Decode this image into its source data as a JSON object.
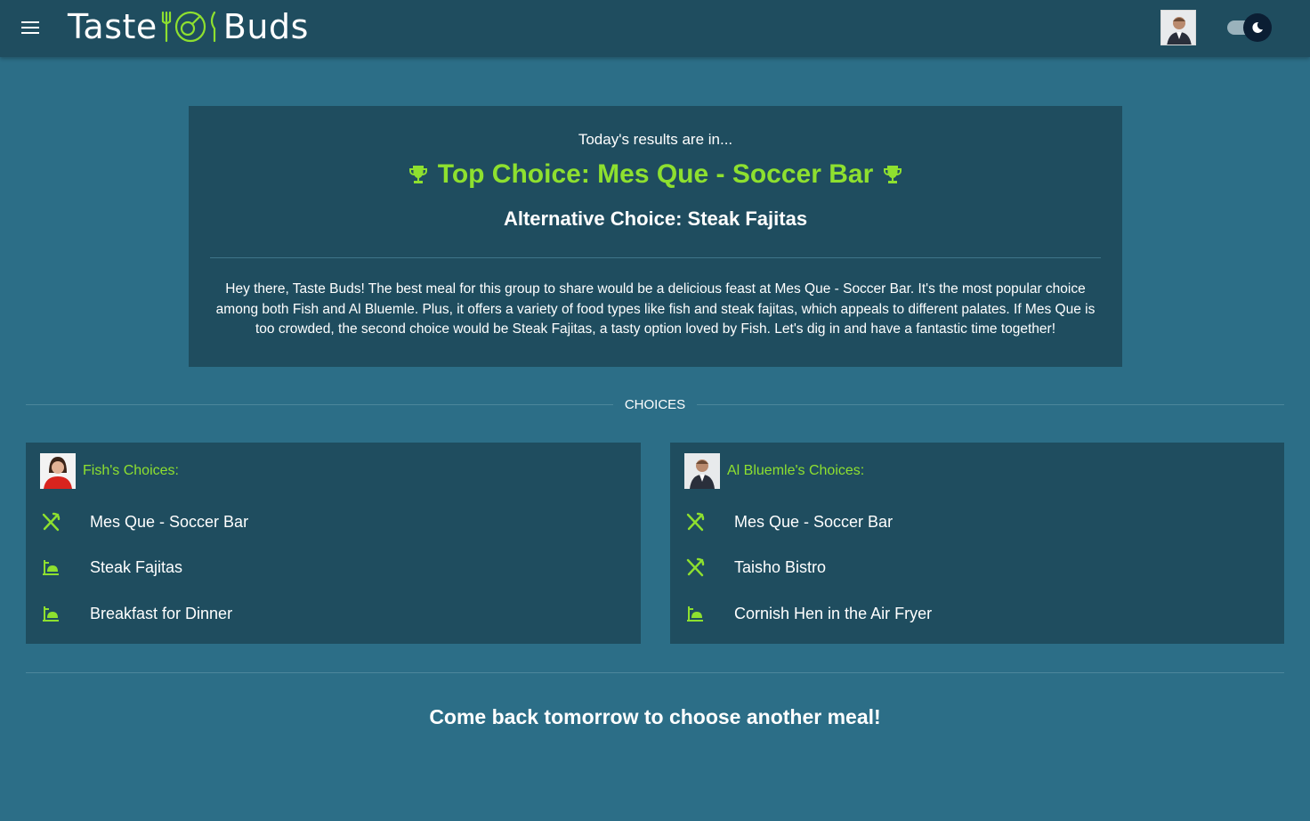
{
  "app": {
    "logo_left": "Taste",
    "logo_right": "Buds"
  },
  "colors": {
    "accent": "#8ee02f",
    "panel": "#1f4d5f",
    "background": "#2c6e87"
  },
  "results": {
    "intro": "Today's results are in...",
    "top_choice": "Top Choice: Mes Que - Soccer Bar",
    "alternative_choice": "Alternative Choice: Steak Fajitas",
    "summary": "Hey there, Taste Buds! The best meal for this group to share would be a delicious feast at Mes Que - Soccer Bar. It's the most popular choice among both Fish and Al Bluemle. Plus, it offers a variety of food types like fish and steak fajitas, which appeals to different palates. If Mes Que is too crowded, the second choice would be Steak Fajitas, a tasty option loved by Fish. Let's dig in and have a fantastic time together!"
  },
  "section_label": "CHOICES",
  "cards": [
    {
      "title": "Fish's Choices:",
      "items": [
        {
          "label": "Mes Que - Soccer Bar",
          "icon": "restaurant-icon"
        },
        {
          "label": "Steak Fajitas",
          "icon": "home-cooking-icon"
        },
        {
          "label": "Breakfast for Dinner",
          "icon": "home-cooking-icon"
        }
      ]
    },
    {
      "title": "Al Bluemle's Choices:",
      "items": [
        {
          "label": "Mes Que - Soccer Bar",
          "icon": "restaurant-icon"
        },
        {
          "label": "Taisho Bistro",
          "icon": "restaurant-icon"
        },
        {
          "label": "Cornish Hen in the Air Fryer",
          "icon": "home-cooking-icon"
        }
      ]
    }
  ],
  "footer": "Come back tomorrow to choose another meal!"
}
